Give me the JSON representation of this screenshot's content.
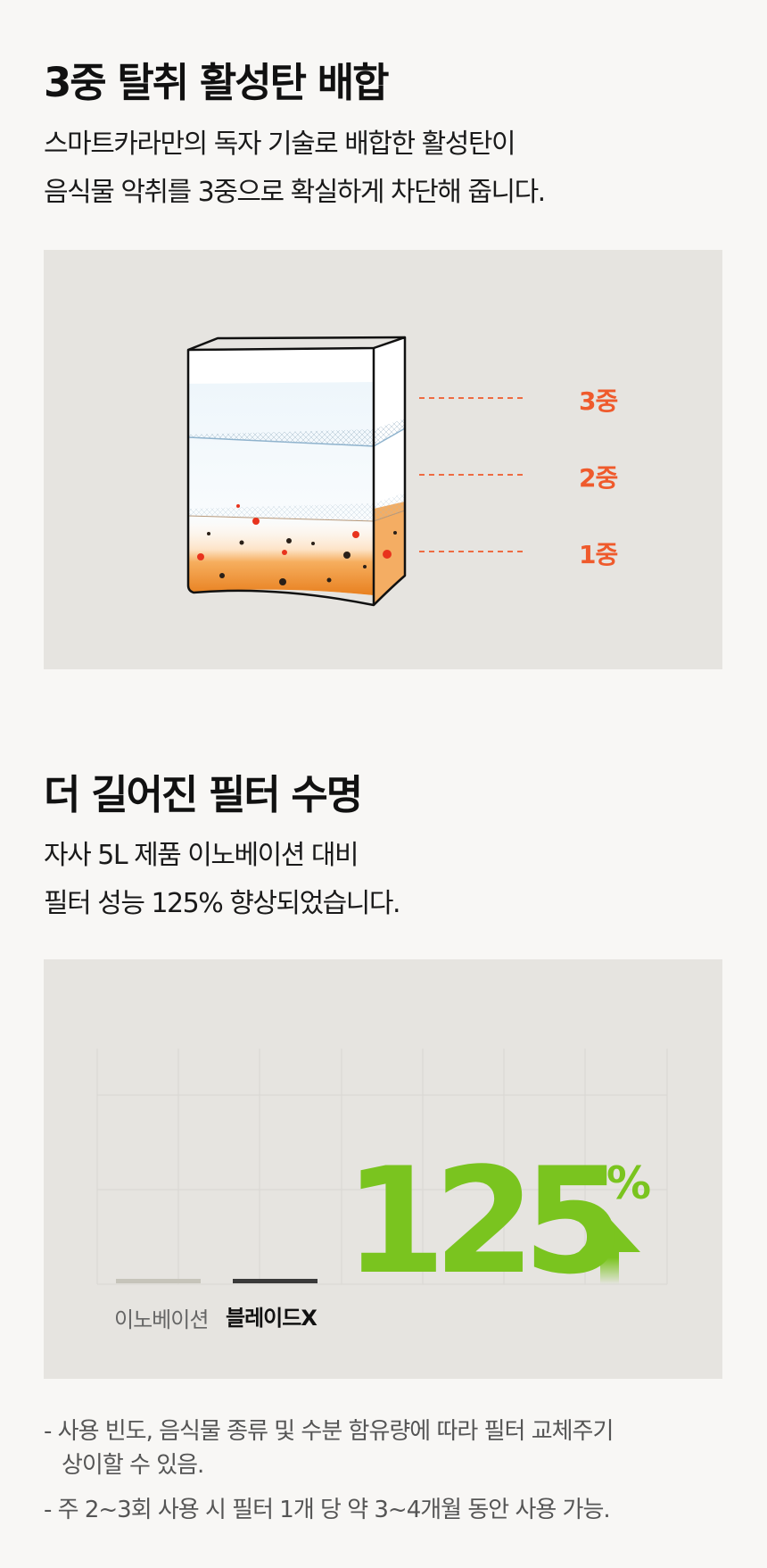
{
  "section1": {
    "title": "3중 탈취 활성탄 배합",
    "desc_line1": "스마트카라만의 독자 기술로 배합한 활성탄이",
    "desc_line2": "음식물 악취를 3중으로 확실하게 차단해 줍니다.",
    "layers": [
      "3중",
      "2중",
      "1중"
    ]
  },
  "section2": {
    "title": "더 길어진 필터 수명",
    "desc_line1": "자사 5L 제품 이노베이션 대비",
    "desc_line2": "필터 성능 125% 향상되었습니다.",
    "bar_labels": [
      "이노베이션",
      "블레이드X"
    ],
    "stat_value": "125",
    "stat_unit": "%"
  },
  "notes": {
    "note1_line1": "- 사용 빈도, 음식물 종류 및 수분 함유량에 따라 필터 교체주기",
    "note1_line2": "상이할 수 있음.",
    "note2": "- 주 2~3회 사용 시 필터 1개 당 약 3~4개월 동안 사용 가능."
  },
  "colors": {
    "accent_orange": "#ef5a2c",
    "accent_green": "#7ac41f",
    "panel_bg": "#e6e4e0"
  }
}
